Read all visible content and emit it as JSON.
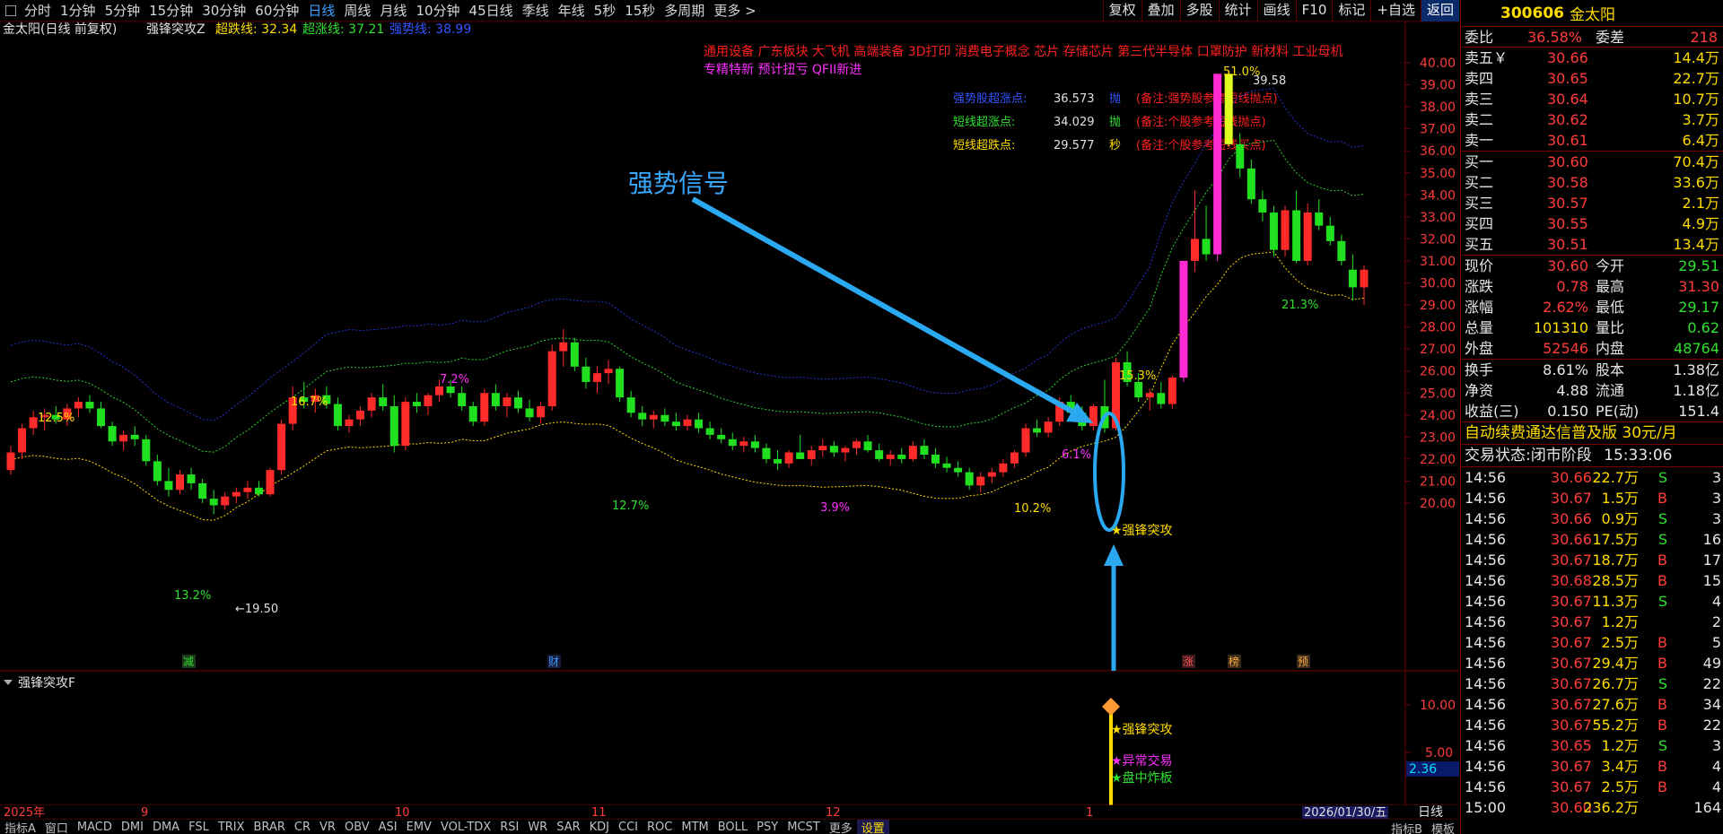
{
  "toolbar": {
    "periods": [
      "分时",
      "1分钟",
      "5分钟",
      "15分钟",
      "30分钟",
      "60分钟",
      "日线",
      "周线",
      "月线",
      "10分钟",
      "45日线",
      "季线",
      "年线",
      "5秒",
      "15秒",
      "多周期",
      "更多 >"
    ],
    "active_period": "日线",
    "tools": [
      "复权",
      "叠加",
      "多股",
      "统计",
      "画线",
      "F10",
      "标记",
      "+自选",
      "返回"
    ]
  },
  "main": {
    "legend_title": "金太阳(日线 前复权)",
    "indicator_name": "强锋突攻Z",
    "super_fall_label": "超跌线: 32.34",
    "super_rise_label": "超涨线: 37.21",
    "strong_line_label": "强势线: 38.99",
    "concepts_line1": "通用设备   广东板块   大飞机 高端装备 3D打印 消费电子概念 芯片 存储芯片 第三代半导体 口罩防护 新材料 工业母机",
    "concepts_line2": "专精特新 预计扭亏 QFII新进",
    "info_rows": [
      {
        "label": "强势股超涨点:",
        "value": "36.573",
        "action": "抛",
        "note": "(备注:强势股参考短线抛点)"
      },
      {
        "label": "短线超涨点:",
        "value": "34.029",
        "action": "抛",
        "note": "(备注:个股参考短线抛点)"
      },
      {
        "label": "短线超跌点:",
        "value": "29.577",
        "action": "秒",
        "note": "(备注:个股参考短线买点)"
      }
    ],
    "annotation_text": "强势信号",
    "signal_label": "★强锋突攻",
    "price_axis": [
      "40.00",
      "39.00",
      "38.00",
      "37.00",
      "36.00",
      "35.00",
      "34.00",
      "33.00",
      "32.00",
      "31.00",
      "30.00",
      "29.00",
      "28.00",
      "27.00",
      "26.00",
      "25.00",
      "24.00",
      "23.00",
      "22.00",
      "21.00",
      "20.00"
    ],
    "pct_labels": [
      "12.5%",
      "16.7%",
      "7.2%",
      "12.7%",
      "13.2%",
      "3.9%",
      "10.2%",
      "6.1%",
      "15.3%",
      "51.0%",
      "21.3%"
    ],
    "low_label": "←19.50",
    "high_label": "39.58",
    "markers": [
      "减",
      "财",
      "涨",
      "榜",
      "预"
    ]
  },
  "sub": {
    "title": "强锋突攻F",
    "axis": [
      "10.00",
      "5.00"
    ],
    "current_value": "2.36",
    "signals": [
      "★强锋突攻",
      "★异常交易",
      "★盘中炸板"
    ]
  },
  "timeaxis": {
    "labels": [
      "2025年",
      "9",
      "10",
      "11",
      "12",
      "1"
    ],
    "date_box": "2026/01/30/五",
    "period": "日线"
  },
  "bottom": {
    "tabs": [
      "指标A",
      "窗口",
      "MACD",
      "DMI",
      "DMA",
      "FSL",
      "TRIX",
      "BRAR",
      "CR",
      "VR",
      "OBV",
      "ASI",
      "EMV",
      "VOL-TDX",
      "RSI",
      "WR",
      "SAR",
      "KDJ",
      "CCI",
      "ROC",
      "MTM",
      "BOLL",
      "PSY",
      "MCST",
      "更多",
      "设置"
    ],
    "right_tabs": [
      "指标B",
      "模板"
    ]
  },
  "quote": {
    "code": "300606",
    "name": "金太阳",
    "commission_ratio_label": "委比",
    "commission_ratio": "36.58%",
    "commission_diff_label": "委差",
    "commission_diff": "218",
    "asks": [
      {
        "label": "卖五￥",
        "price": "30.66",
        "vol": "14.4万"
      },
      {
        "label": "卖四",
        "price": "30.65",
        "vol": "22.7万"
      },
      {
        "label": "卖三",
        "price": "30.64",
        "vol": "10.7万"
      },
      {
        "label": "卖二",
        "price": "30.62",
        "vol": "3.7万"
      },
      {
        "label": "卖一",
        "price": "30.61",
        "vol": "6.4万"
      }
    ],
    "bids": [
      {
        "label": "买一",
        "price": "30.60",
        "vol": "70.4万"
      },
      {
        "label": "买二",
        "price": "30.58",
        "vol": "33.6万"
      },
      {
        "label": "买三",
        "price": "30.57",
        "vol": "2.1万"
      },
      {
        "label": "买四",
        "price": "30.55",
        "vol": "4.9万"
      },
      {
        "label": "买五",
        "price": "30.51",
        "vol": "13.4万"
      }
    ],
    "stats": [
      {
        "l1": "现价",
        "v1": "30.60",
        "c1": "red",
        "l2": "今开",
        "v2": "29.51",
        "c2": "grn"
      },
      {
        "l1": "涨跌",
        "v1": "0.78",
        "c1": "red",
        "l2": "最高",
        "v2": "31.30",
        "c2": "red"
      },
      {
        "l1": "涨幅",
        "v1": "2.62%",
        "c1": "red",
        "l2": "最低",
        "v2": "29.17",
        "c2": "grn"
      },
      {
        "l1": "总量",
        "v1": "101310",
        "c1": "yel",
        "l2": "量比",
        "v2": "0.62",
        "c2": "grn"
      },
      {
        "l1": "外盘",
        "v1": "52546",
        "c1": "red",
        "l2": "内盘",
        "v2": "48764",
        "c2": "grn"
      }
    ],
    "stats2": [
      {
        "l1": "换手",
        "v1": "8.61%",
        "l2": "股本",
        "v2": "1.38亿"
      },
      {
        "l1": "净资",
        "v1": "4.88",
        "l2": "流通",
        "v2": "1.18亿"
      },
      {
        "l1": "收益(三)",
        "v1": "0.150",
        "l2": "PE(动)",
        "v2": "151.4"
      }
    ],
    "ad_text": "自动续费通达信普及版  30元/月",
    "status_label": "交易状态:",
    "status_value": "闭市阶段",
    "status_time": "15:33:06",
    "ticks": [
      {
        "t": "14:56",
        "p": "30.66",
        "v": "22.7万",
        "bs": "S",
        "n": "3"
      },
      {
        "t": "14:56",
        "p": "30.67",
        "v": "1.5万",
        "bs": "B",
        "n": "3"
      },
      {
        "t": "14:56",
        "p": "30.66",
        "v": "0.9万",
        "bs": "S",
        "n": "3"
      },
      {
        "t": "14:56",
        "p": "30.66",
        "v": "17.5万",
        "bs": "S",
        "n": "16"
      },
      {
        "t": "14:56",
        "p": "30.67",
        "v": "18.7万",
        "bs": "B",
        "n": "17"
      },
      {
        "t": "14:56",
        "p": "30.68",
        "v": "28.5万",
        "bs": "B",
        "n": "15"
      },
      {
        "t": "14:56",
        "p": "30.67",
        "v": "11.3万",
        "bs": "S",
        "n": "4"
      },
      {
        "t": "14:56",
        "p": "30.67",
        "v": "1.2万",
        "bs": "",
        "n": "2"
      },
      {
        "t": "14:56",
        "p": "30.67",
        "v": "2.5万",
        "bs": "B",
        "n": "5"
      },
      {
        "t": "14:56",
        "p": "30.67",
        "v": "29.4万",
        "bs": "B",
        "n": "49"
      },
      {
        "t": "14:56",
        "p": "30.67",
        "v": "26.7万",
        "bs": "S",
        "n": "22"
      },
      {
        "t": "14:56",
        "p": "30.67",
        "v": "27.6万",
        "bs": "B",
        "n": "34"
      },
      {
        "t": "14:56",
        "p": "30.67",
        "v": "55.2万",
        "bs": "B",
        "n": "22"
      },
      {
        "t": "14:56",
        "p": "30.65",
        "v": "1.2万",
        "bs": "S",
        "n": "3"
      },
      {
        "t": "14:56",
        "p": "30.67",
        "v": "3.4万",
        "bs": "B",
        "n": "4"
      },
      {
        "t": "14:56",
        "p": "30.67",
        "v": "2.5万",
        "bs": "B",
        "n": "4"
      },
      {
        "t": "15:00",
        "p": "30.60",
        "v": "236.2万",
        "bs": "",
        "n": "164"
      }
    ]
  },
  "chart_data": {
    "type": "candlestick",
    "y_range": [
      19.5,
      40.5
    ],
    "ohlc": [
      [
        21.5,
        22.6,
        21.3,
        22.3
      ],
      [
        22.3,
        23.6,
        22.0,
        23.4
      ],
      [
        23.4,
        24.2,
        23.1,
        23.9
      ],
      [
        23.9,
        24.3,
        23.3,
        24.0
      ],
      [
        24.0,
        24.4,
        23.6,
        23.8
      ],
      [
        23.8,
        24.5,
        23.5,
        24.3
      ],
      [
        24.3,
        24.8,
        23.9,
        24.6
      ],
      [
        24.6,
        24.9,
        24.1,
        24.3
      ],
      [
        24.3,
        24.6,
        23.4,
        23.5
      ],
      [
        23.5,
        23.7,
        22.6,
        22.8
      ],
      [
        22.8,
        23.3,
        22.4,
        23.1
      ],
      [
        23.1,
        23.5,
        22.6,
        22.9
      ],
      [
        22.9,
        23.1,
        21.7,
        21.9
      ],
      [
        21.9,
        22.2,
        20.8,
        21.0
      ],
      [
        21.0,
        21.6,
        20.3,
        20.6
      ],
      [
        20.6,
        21.5,
        20.4,
        21.3
      ],
      [
        21.3,
        21.6,
        20.6,
        20.9
      ],
      [
        20.9,
        21.1,
        20.0,
        20.2
      ],
      [
        20.2,
        20.6,
        19.5,
        19.9
      ],
      [
        19.9,
        20.5,
        19.7,
        20.3
      ],
      [
        20.3,
        20.7,
        20.0,
        20.5
      ],
      [
        20.5,
        21.0,
        20.2,
        20.7
      ],
      [
        20.7,
        21.0,
        20.3,
        20.4
      ],
      [
        20.4,
        21.6,
        20.3,
        21.5
      ],
      [
        21.5,
        23.8,
        21.3,
        23.6
      ],
      [
        23.6,
        25.3,
        23.3,
        24.8
      ],
      [
        24.8,
        25.5,
        24.3,
        24.6
      ],
      [
        24.6,
        25.2,
        24.1,
        24.9
      ],
      [
        24.9,
        25.3,
        24.3,
        24.5
      ],
      [
        24.5,
        24.8,
        23.3,
        23.5
      ],
      [
        23.5,
        24.0,
        23.2,
        23.8
      ],
      [
        23.8,
        24.4,
        23.5,
        24.2
      ],
      [
        24.2,
        25.0,
        23.9,
        24.8
      ],
      [
        24.8,
        25.4,
        24.2,
        24.4
      ],
      [
        24.4,
        24.9,
        22.3,
        22.6
      ],
      [
        22.6,
        24.8,
        22.4,
        24.6
      ],
      [
        24.6,
        25.0,
        24.1,
        24.4
      ],
      [
        24.4,
        25.0,
        24.0,
        24.9
      ],
      [
        24.9,
        25.6,
        24.6,
        25.3
      ],
      [
        25.3,
        25.6,
        24.8,
        25.0
      ],
      [
        25.0,
        25.3,
        24.2,
        24.4
      ],
      [
        24.4,
        24.6,
        23.5,
        23.7
      ],
      [
        23.7,
        25.2,
        23.5,
        25.0
      ],
      [
        25.0,
        25.4,
        24.2,
        24.4
      ],
      [
        24.4,
        25.0,
        23.9,
        24.8
      ],
      [
        24.8,
        25.1,
        24.1,
        24.3
      ],
      [
        24.3,
        24.7,
        23.7,
        23.9
      ],
      [
        23.9,
        24.6,
        23.6,
        24.4
      ],
      [
        24.4,
        27.2,
        24.2,
        26.9
      ],
      [
        26.9,
        27.9,
        26.2,
        27.3
      ],
      [
        27.3,
        27.5,
        26.0,
        26.2
      ],
      [
        26.2,
        26.6,
        25.2,
        25.5
      ],
      [
        25.5,
        26.2,
        25.0,
        25.9
      ],
      [
        25.9,
        26.5,
        25.4,
        26.1
      ],
      [
        26.1,
        26.2,
        24.6,
        24.8
      ],
      [
        24.8,
        25.1,
        23.9,
        24.1
      ],
      [
        24.1,
        24.4,
        23.5,
        23.8
      ],
      [
        23.8,
        24.2,
        23.4,
        24.0
      ],
      [
        24.0,
        24.3,
        23.5,
        23.7
      ],
      [
        23.7,
        24.1,
        23.3,
        23.5
      ],
      [
        23.5,
        24.0,
        23.3,
        23.8
      ],
      [
        23.8,
        24.1,
        23.2,
        23.4
      ],
      [
        23.4,
        23.7,
        22.9,
        23.1
      ],
      [
        23.1,
        23.4,
        22.7,
        22.9
      ],
      [
        22.9,
        23.2,
        22.4,
        22.6
      ],
      [
        22.6,
        23.0,
        22.3,
        22.8
      ],
      [
        22.8,
        23.1,
        22.3,
        22.5
      ],
      [
        22.5,
        22.7,
        21.8,
        22.0
      ],
      [
        22.0,
        22.4,
        21.5,
        21.8
      ],
      [
        21.8,
        22.4,
        21.6,
        22.3
      ],
      [
        22.3,
        23.1,
        22.0,
        22.0
      ],
      [
        22.0,
        22.6,
        21.7,
        22.4
      ],
      [
        22.4,
        22.9,
        22.1,
        22.6
      ],
      [
        22.6,
        22.8,
        22.1,
        22.3
      ],
      [
        22.3,
        22.6,
        21.9,
        22.5
      ],
      [
        22.5,
        22.9,
        22.2,
        22.8
      ],
      [
        22.8,
        23.1,
        22.3,
        22.4
      ],
      [
        22.4,
        22.7,
        21.9,
        22.0
      ],
      [
        22.0,
        22.4,
        21.7,
        22.2
      ],
      [
        22.2,
        22.5,
        21.8,
        22.0
      ],
      [
        22.0,
        22.8,
        21.9,
        22.6
      ],
      [
        22.6,
        22.9,
        22.0,
        22.2
      ],
      [
        22.2,
        22.5,
        21.6,
        21.8
      ],
      [
        21.8,
        22.1,
        21.4,
        21.6
      ],
      [
        21.6,
        21.9,
        21.2,
        21.4
      ],
      [
        21.4,
        21.6,
        20.6,
        20.8
      ],
      [
        20.8,
        21.4,
        20.5,
        21.2
      ],
      [
        21.2,
        21.6,
        20.9,
        21.4
      ],
      [
        21.4,
        22.0,
        21.2,
        21.8
      ],
      [
        21.8,
        22.4,
        21.6,
        22.3
      ],
      [
        22.3,
        23.6,
        22.1,
        23.4
      ],
      [
        23.4,
        23.8,
        23.0,
        23.2
      ],
      [
        23.2,
        23.9,
        23.0,
        23.7
      ],
      [
        23.7,
        24.8,
        23.5,
        24.6
      ],
      [
        24.6,
        24.9,
        23.8,
        24.1
      ],
      [
        24.1,
        24.4,
        23.3,
        23.5
      ],
      [
        23.5,
        24.5,
        23.3,
        24.4
      ],
      [
        24.4,
        25.6,
        23.2,
        23.4
      ],
      [
        23.4,
        26.6,
        23.3,
        26.4
      ],
      [
        26.4,
        26.9,
        25.3,
        25.5
      ],
      [
        25.5,
        25.9,
        24.6,
        24.8
      ],
      [
        24.8,
        25.2,
        24.2,
        25.0
      ],
      [
        25.0,
        25.5,
        24.3,
        24.5
      ],
      [
        24.5,
        25.8,
        24.3,
        25.7
      ],
      [
        25.7,
        31.0,
        25.5,
        31.0
      ],
      [
        31.0,
        34.2,
        30.5,
        32.0
      ],
      [
        32.0,
        33.5,
        31.0,
        31.3
      ],
      [
        31.3,
        39.5,
        31.0,
        39.5
      ],
      [
        39.5,
        39.6,
        36.2,
        36.3
      ],
      [
        36.3,
        36.8,
        34.8,
        35.2
      ],
      [
        35.2,
        35.6,
        33.6,
        33.8
      ],
      [
        33.8,
        34.2,
        32.8,
        33.2
      ],
      [
        33.2,
        33.5,
        31.2,
        31.5
      ],
      [
        31.5,
        33.5,
        31.2,
        33.3
      ],
      [
        33.3,
        34.2,
        30.9,
        31.0
      ],
      [
        31.0,
        33.6,
        30.8,
        33.2
      ],
      [
        33.2,
        33.8,
        32.4,
        32.6
      ],
      [
        32.6,
        33.0,
        31.7,
        31.9
      ],
      [
        31.9,
        32.2,
        30.8,
        31.0
      ],
      [
        30.6,
        31.3,
        29.2,
        29.8
      ],
      [
        29.8,
        30.8,
        29.0,
        30.6
      ]
    ]
  }
}
